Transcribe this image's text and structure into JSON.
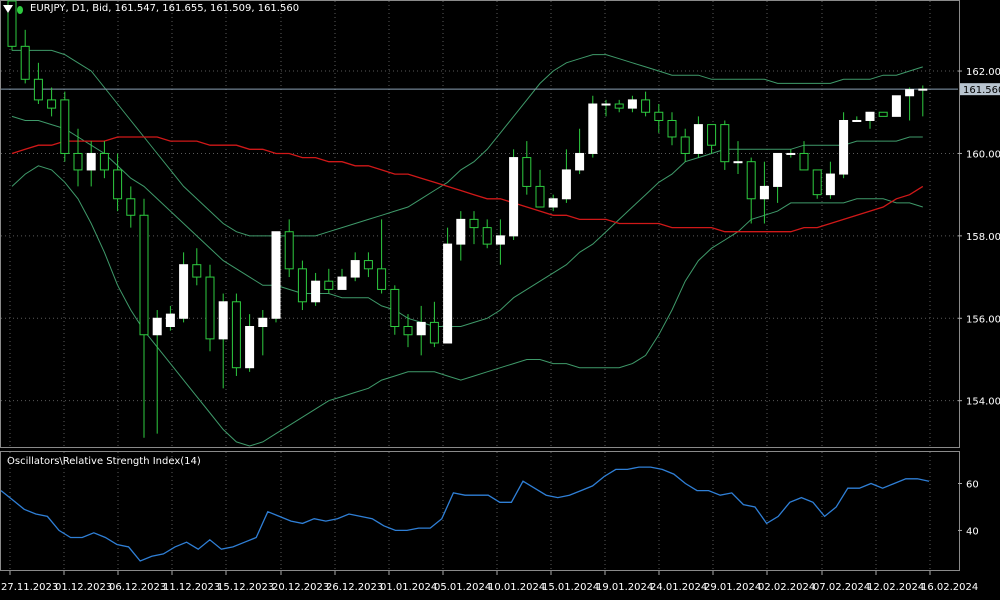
{
  "header": {
    "symbol_info": "EURJPY, D1, Bid, 161.547, 161.655, 161.509, 161.560",
    "rsi_title": "Oscillators\\Relative Strength Index(14)"
  },
  "colors": {
    "background": "#000000",
    "bull_candle": "#ffffff",
    "wick": "#2ecc40",
    "bands": "#3f9a6a",
    "ma_red": "#d01818",
    "rsi_line": "#2f7fd6",
    "grid": "#5a5a5a",
    "current_price_line": "#8aa0b4"
  },
  "chart_data": [
    {
      "type": "candlestick",
      "symbol": "EURJPY",
      "timeframe": "D1",
      "current_price": "161.560",
      "ylim": [
        152.9,
        163.7
      ],
      "y_ticks": [
        "162.000",
        "160.000",
        "158.000",
        "156.000",
        "154.000"
      ],
      "x_ticks": [
        "27.11.2023",
        "01.12.2023",
        "06.12.2023",
        "11.12.2023",
        "15.12.2023",
        "20.12.2023",
        "26.12.2023",
        "01.01.2024",
        "05.01.2024",
        "10.01.2024",
        "15.01.2024",
        "19.01.2024",
        "24.01.2024",
        "29.01.2024",
        "02.02.2024",
        "07.02.2024",
        "12.02.2024",
        "16.02.2024"
      ],
      "grid": true,
      "ohlc": [
        [
          163.7,
          163.7,
          162.5,
          162.6
        ],
        [
          162.6,
          163.0,
          161.7,
          161.8
        ],
        [
          161.8,
          162.2,
          161.2,
          161.3
        ],
        [
          161.3,
          161.6,
          160.9,
          161.1
        ],
        [
          161.3,
          161.5,
          159.8,
          160.0
        ],
        [
          160.0,
          160.6,
          159.2,
          159.6
        ],
        [
          159.6,
          160.3,
          159.2,
          160.0
        ],
        [
          160.0,
          160.3,
          159.4,
          159.6
        ],
        [
          159.6,
          160.0,
          158.6,
          158.9
        ],
        [
          158.9,
          159.2,
          158.2,
          158.5
        ],
        [
          158.5,
          158.9,
          153.1,
          155.6
        ],
        [
          155.6,
          156.2,
          153.2,
          156.0
        ],
        [
          155.8,
          156.3,
          155.7,
          156.1
        ],
        [
          156.0,
          157.6,
          155.9,
          157.3
        ],
        [
          157.3,
          157.7,
          156.8,
          157.0
        ],
        [
          157.0,
          157.3,
          155.2,
          155.5
        ],
        [
          155.5,
          156.6,
          154.3,
          156.4
        ],
        [
          156.4,
          156.6,
          154.6,
          154.8
        ],
        [
          154.8,
          156.1,
          154.7,
          155.8
        ],
        [
          155.8,
          156.2,
          155.1,
          156.0
        ],
        [
          156.0,
          158.1,
          155.9,
          158.1
        ],
        [
          158.1,
          158.4,
          157.0,
          157.2
        ],
        [
          157.2,
          157.4,
          156.2,
          156.4
        ],
        [
          156.4,
          157.1,
          156.3,
          156.9
        ],
        [
          156.9,
          157.2,
          156.6,
          156.7
        ],
        [
          156.7,
          157.2,
          156.7,
          157.0
        ],
        [
          157.0,
          157.6,
          156.9,
          157.4
        ],
        [
          157.4,
          157.6,
          157.0,
          157.2
        ],
        [
          157.2,
          158.4,
          156.6,
          156.7
        ],
        [
          156.7,
          156.8,
          155.6,
          155.8
        ],
        [
          155.8,
          156.1,
          155.3,
          155.6
        ],
        [
          155.6,
          156.3,
          155.1,
          155.9
        ],
        [
          155.9,
          156.4,
          155.3,
          155.4
        ],
        [
          155.4,
          158.2,
          156.2,
          157.8
        ],
        [
          157.8,
          158.6,
          157.4,
          158.4
        ],
        [
          158.4,
          158.6,
          157.8,
          158.2
        ],
        [
          158.2,
          158.4,
          157.7,
          157.8
        ],
        [
          157.8,
          158.4,
          157.3,
          158.0
        ],
        [
          158.0,
          160.1,
          157.9,
          159.9
        ],
        [
          159.9,
          160.3,
          159.0,
          159.2
        ],
        [
          159.2,
          159.6,
          158.9,
          158.7
        ],
        [
          158.7,
          159.0,
          158.6,
          158.9
        ],
        [
          158.9,
          160.1,
          158.8,
          159.6
        ],
        [
          159.6,
          160.6,
          159.5,
          160.0
        ],
        [
          160.0,
          161.4,
          159.9,
          161.2
        ],
        [
          161.2,
          161.3,
          160.9,
          161.2
        ],
        [
          161.2,
          161.3,
          161.0,
          161.1
        ],
        [
          161.1,
          161.4,
          161.0,
          161.3
        ],
        [
          161.3,
          161.5,
          160.9,
          161.0
        ],
        [
          161.0,
          161.2,
          160.5,
          160.8
        ],
        [
          160.8,
          161.0,
          160.2,
          160.4
        ],
        [
          160.4,
          160.6,
          159.8,
          160.0
        ],
        [
          160.0,
          160.9,
          159.9,
          160.7
        ],
        [
          160.7,
          160.7,
          160.0,
          160.2
        ],
        [
          160.7,
          160.8,
          159.6,
          159.8
        ],
        [
          159.8,
          160.3,
          159.5,
          159.8
        ],
        [
          159.8,
          159.9,
          158.3,
          158.9
        ],
        [
          158.9,
          159.8,
          158.3,
          159.2
        ],
        [
          159.2,
          160.0,
          158.8,
          160.0
        ],
        [
          160.0,
          160.1,
          159.9,
          160.0
        ],
        [
          160.0,
          160.3,
          159.6,
          159.6
        ],
        [
          159.6,
          159.6,
          158.9,
          159.0
        ],
        [
          159.0,
          159.8,
          158.9,
          159.5
        ],
        [
          159.5,
          161.0,
          159.4,
          160.8
        ],
        [
          160.8,
          160.9,
          160.8,
          160.8
        ],
        [
          160.8,
          161.0,
          160.6,
          161.0
        ],
        [
          161.0,
          161.0,
          160.9,
          160.9
        ],
        [
          160.9,
          161.4,
          160.9,
          161.4
        ],
        [
          161.4,
          161.6,
          160.8,
          161.55
        ],
        [
          161.55,
          161.65,
          160.9,
          161.56
        ]
      ],
      "bollinger_middle": [
        160.9,
        160.8,
        160.8,
        160.7,
        160.6,
        160.4,
        160.2,
        160.0,
        159.7,
        159.4,
        159.2,
        158.9,
        158.6,
        158.3,
        158.0,
        157.7,
        157.4,
        157.2,
        157.0,
        156.8,
        156.8,
        156.7,
        156.6,
        156.6,
        156.6,
        156.5,
        156.5,
        156.5,
        156.3,
        156.2,
        156.0,
        155.9,
        155.8,
        155.8,
        155.8,
        155.9,
        156.0,
        156.2,
        156.5,
        156.7,
        156.9,
        157.1,
        157.3,
        157.6,
        157.8,
        158.1,
        158.4,
        158.7,
        159.0,
        159.3,
        159.5,
        159.8,
        159.9,
        160.0,
        160.1,
        160.1,
        160.1,
        160.1,
        160.1,
        160.1,
        160.2,
        160.2,
        160.2,
        160.2,
        160.3,
        160.3,
        160.3,
        160.3,
        160.4,
        160.4
      ],
      "bollinger_upper": [
        162.5,
        162.5,
        162.5,
        162.5,
        162.4,
        162.2,
        162.0,
        161.6,
        161.2,
        160.8,
        160.4,
        160.0,
        159.6,
        159.2,
        158.9,
        158.6,
        158.3,
        158.1,
        158.0,
        158.0,
        158.0,
        158.0,
        158.0,
        158.0,
        158.1,
        158.2,
        158.3,
        158.4,
        158.5,
        158.6,
        158.7,
        158.9,
        159.1,
        159.3,
        159.6,
        159.8,
        160.1,
        160.5,
        160.9,
        161.3,
        161.7,
        162.0,
        162.2,
        162.3,
        162.4,
        162.4,
        162.3,
        162.2,
        162.1,
        162.0,
        161.9,
        161.9,
        161.9,
        161.8,
        161.8,
        161.8,
        161.8,
        161.8,
        161.7,
        161.7,
        161.7,
        161.7,
        161.7,
        161.8,
        161.8,
        161.8,
        161.9,
        161.9,
        162.0,
        162.1
      ],
      "bollinger_lower": [
        159.2,
        159.5,
        159.7,
        159.6,
        159.3,
        158.9,
        158.3,
        157.6,
        156.8,
        156.2,
        155.7,
        155.3,
        154.9,
        154.5,
        154.1,
        153.7,
        153.3,
        153.0,
        152.9,
        153.0,
        153.2,
        153.4,
        153.6,
        153.8,
        154.0,
        154.1,
        154.2,
        154.3,
        154.5,
        154.6,
        154.7,
        154.7,
        154.7,
        154.6,
        154.5,
        154.6,
        154.7,
        154.8,
        154.9,
        155.0,
        155.0,
        154.9,
        154.9,
        154.8,
        154.8,
        154.8,
        154.8,
        154.9,
        155.1,
        155.6,
        156.2,
        156.9,
        157.4,
        157.7,
        157.9,
        158.1,
        158.4,
        158.5,
        158.6,
        158.8,
        158.8,
        158.8,
        158.8,
        158.8,
        158.9,
        158.9,
        158.9,
        158.8,
        158.8,
        158.7
      ],
      "ma_red": [
        160.0,
        160.1,
        160.2,
        160.2,
        160.3,
        160.3,
        160.3,
        160.3,
        160.4,
        160.4,
        160.4,
        160.4,
        160.3,
        160.3,
        160.3,
        160.2,
        160.2,
        160.2,
        160.1,
        160.1,
        160.0,
        160.0,
        159.9,
        159.9,
        159.8,
        159.8,
        159.7,
        159.7,
        159.6,
        159.5,
        159.5,
        159.4,
        159.3,
        159.2,
        159.1,
        159.0,
        158.9,
        158.9,
        158.8,
        158.7,
        158.6,
        158.5,
        158.5,
        158.4,
        158.4,
        158.4,
        158.3,
        158.3,
        158.3,
        158.3,
        158.2,
        158.2,
        158.2,
        158.2,
        158.1,
        158.1,
        158.1,
        158.1,
        158.1,
        158.1,
        158.2,
        158.2,
        158.3,
        158.4,
        158.5,
        158.6,
        158.7,
        158.9,
        159.0,
        159.2
      ]
    },
    {
      "type": "line",
      "name": "Relative Strength Index(14)",
      "ylim": [
        24,
        73
      ],
      "y_ticks": [
        "60",
        "40"
      ],
      "values": [
        57,
        53,
        49,
        47,
        46,
        40,
        37,
        37,
        39,
        37,
        34,
        33,
        27,
        29,
        30,
        33,
        35,
        32,
        36,
        32,
        33,
        35,
        37,
        48,
        46,
        44,
        43,
        45,
        44,
        45,
        47,
        46,
        45,
        42,
        40,
        40,
        41,
        41,
        45,
        56,
        55,
        55,
        55,
        52,
        52,
        61,
        58,
        55,
        54,
        55,
        57,
        59,
        63,
        66,
        66,
        67,
        67,
        66,
        64,
        60,
        57,
        57,
        55,
        56,
        51,
        50,
        43,
        46,
        52,
        54,
        52,
        46,
        50,
        58,
        58,
        60,
        58,
        60,
        62,
        62,
        61
      ]
    }
  ]
}
